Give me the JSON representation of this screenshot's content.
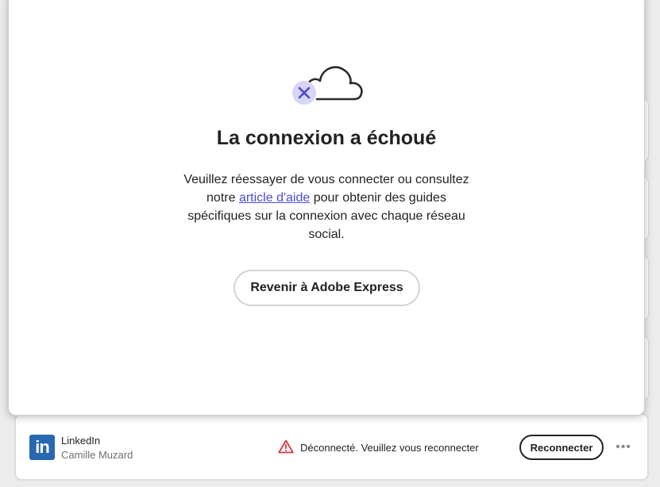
{
  "dialog": {
    "title": "La connexion a échoué",
    "body_before_link": "Veuillez réessayer de vous connecter ou consultez notre ",
    "help_link": "article d'aide",
    "body_after_link": " pour obtenir des guides spécifiques sur la connexion avec chaque réseau social.",
    "back_button": "Revenir à Adobe Express",
    "icon": "cloud-error-icon"
  },
  "account": {
    "logo_text": "in",
    "network": "LinkedIn",
    "user": "Camille Muzard",
    "status_icon": "warning-icon",
    "status_text": "Déconnecté. Veuillez vous reconnecter",
    "reconnect_button": "Reconnecter",
    "more_label": "•••"
  },
  "colors": {
    "accent": "#4b4bd6",
    "linkedin": "#2867b2",
    "warning": "#d7373f"
  }
}
